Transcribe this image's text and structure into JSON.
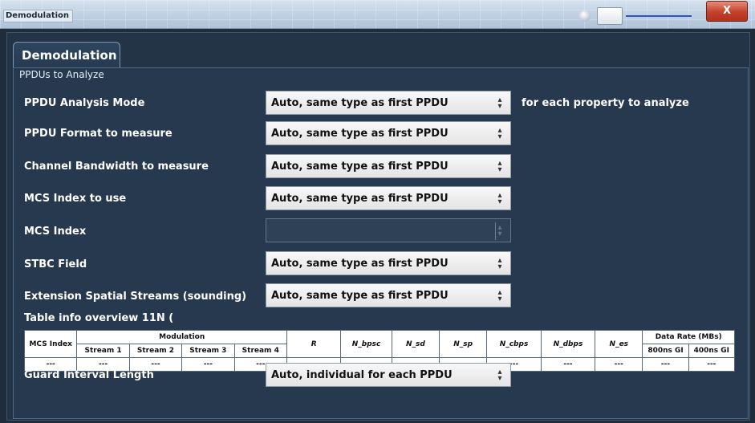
{
  "window": {
    "title": "Demodulation",
    "close_label": "X"
  },
  "tab": {
    "label": "Demodulation"
  },
  "section": {
    "label": "PPDUs to Analyze"
  },
  "fields": [
    {
      "label": "PPDU Analysis Mode",
      "value": "Auto, same type as first PPDU"
    },
    {
      "label": "PPDU Format to measure",
      "value": "Auto, same type as first PPDU"
    },
    {
      "label": "Channel Bandwidth to measure",
      "value": "Auto, same type as first PPDU"
    },
    {
      "label": "MCS Index to use",
      "value": "Auto, same type as first PPDU"
    },
    {
      "label": "MCS Index",
      "value": ""
    },
    {
      "label": "STBC Field",
      "value": "Auto, same type as first PPDU"
    },
    {
      "label": "Extension Spatial Streams (sounding)",
      "value": "Auto, same type as first PPDU"
    }
  ],
  "analysis_mode_hint": "for each property to analyze",
  "table": {
    "title": "Table info overview 11N (",
    "headers": {
      "mcs_index": "MCS Index",
      "modulation": "Modulation",
      "streams": [
        "Stream 1",
        "Stream 2",
        "Stream 3",
        "Stream 4"
      ],
      "r": "R",
      "n_bpsc": "N_bpsc",
      "n_sd": "N_sd",
      "n_sp": "N_sp",
      "n_cbps": "N_cbps",
      "n_dbps": "N_dbps",
      "n_es": "N_es",
      "data_rate": "Data Rate (MBs)",
      "gi_800": "800ns GI",
      "gi_400": "400ns GI"
    },
    "row": [
      "---",
      "---",
      "---",
      "---",
      "---",
      "---",
      "---",
      "---",
      "---",
      "---",
      "---",
      "---",
      "---",
      "---"
    ]
  },
  "guard_interval": {
    "label": "Guard Interval Length",
    "value": "Auto, individual for each PPDU"
  },
  "colors": {
    "panel_bg": "#26394f",
    "dropdown_bg": "#f0f0f0",
    "close_button": "#c4412b"
  },
  "icons": [
    "close-icon",
    "dropdown-arrows-icon"
  ]
}
